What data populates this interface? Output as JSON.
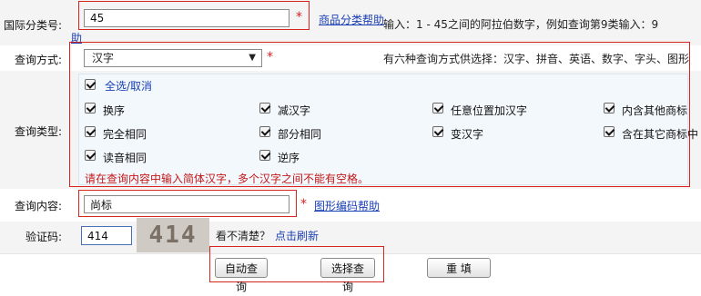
{
  "class_no": {
    "label": "国际分类号:",
    "value": "45",
    "link": "商品分类帮助",
    "link_wrap": "助",
    "hint": "输入：1 - 45之间的阿拉伯数字，例如查询第9类输入：9"
  },
  "query_method": {
    "label": "查询方式:",
    "selected": "汉字",
    "hint": "有六种查询方式供选择：汉字、拼音、英语、数字、字头、图形"
  },
  "query_type": {
    "label": "查询类型:",
    "select_all": "全选/取消",
    "options": [
      "换序",
      "减汉字",
      "任意位置加汉字",
      "内含其他商标",
      "完全相同",
      "部分相同",
      "变汉字",
      "含在其它商标中",
      "读音相同",
      "逆序"
    ],
    "warning": "请在查询内容中输入简体汉字，多个汉字之间不能有空格。"
  },
  "query_content": {
    "label": "查询内容:",
    "value": "尚标",
    "link": "图形编码帮助"
  },
  "captcha": {
    "label": "验证码:",
    "value": "414",
    "image_text": "414",
    "unclear": "看不清楚？",
    "refresh": "点击刷新"
  },
  "buttons": {
    "auto_query": "自动查询",
    "select_query": "选择查询",
    "reset": "重 填"
  },
  "required_mark": "*",
  "colors": {
    "highlight_border": "#d9231d",
    "link": "#1a3fb5",
    "panel_bg": "#f3f8fd",
    "row_bg": "#f4f4f4"
  }
}
